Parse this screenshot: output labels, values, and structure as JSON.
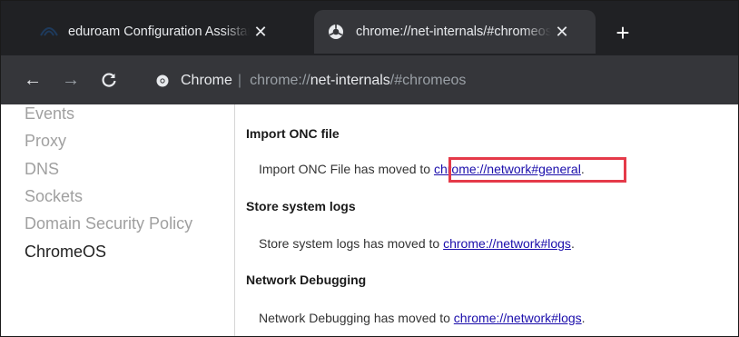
{
  "browser": {
    "tabs": [
      {
        "title": "eduroam Configuration Assistant Tool",
        "close_glyph": "✕",
        "favicon": "eduroam-icon"
      },
      {
        "title": "chrome://net-internals/#chromeos",
        "close_glyph": "✕",
        "favicon": "globe-icon"
      }
    ],
    "new_tab_glyph": "+",
    "toolbar": {
      "back_glyph": "←",
      "forward_glyph": "→",
      "reload_glyph": "C",
      "chip_label": "Chrome",
      "separator": "|",
      "url_scheme": "chrome://",
      "url_host": "net-internals",
      "url_rest": "/#chromeos"
    }
  },
  "sidebar": {
    "items": [
      {
        "label": "Events",
        "active": false
      },
      {
        "label": "Proxy",
        "active": false
      },
      {
        "label": "DNS",
        "active": false
      },
      {
        "label": "Sockets",
        "active": false
      },
      {
        "label": "Domain Security Policy",
        "active": false
      },
      {
        "label": "ChromeOS",
        "active": true
      }
    ]
  },
  "main": {
    "sections": [
      {
        "heading": "Import ONC file",
        "text": "Import ONC File has moved to ",
        "link": "chrome://network#general",
        "suffix": "."
      },
      {
        "heading": "Store system logs",
        "text": "Store system logs has moved to ",
        "link": "chrome://network#logs",
        "suffix": "."
      },
      {
        "heading": "Network Debugging",
        "text": "Network Debugging has moved to ",
        "link": "chrome://network#logs",
        "suffix": "."
      }
    ]
  },
  "colors": {
    "tabstrip": "#202124",
    "toolbar": "#35363a",
    "link": "#1a0dab",
    "highlight_box": "#e53a49"
  }
}
